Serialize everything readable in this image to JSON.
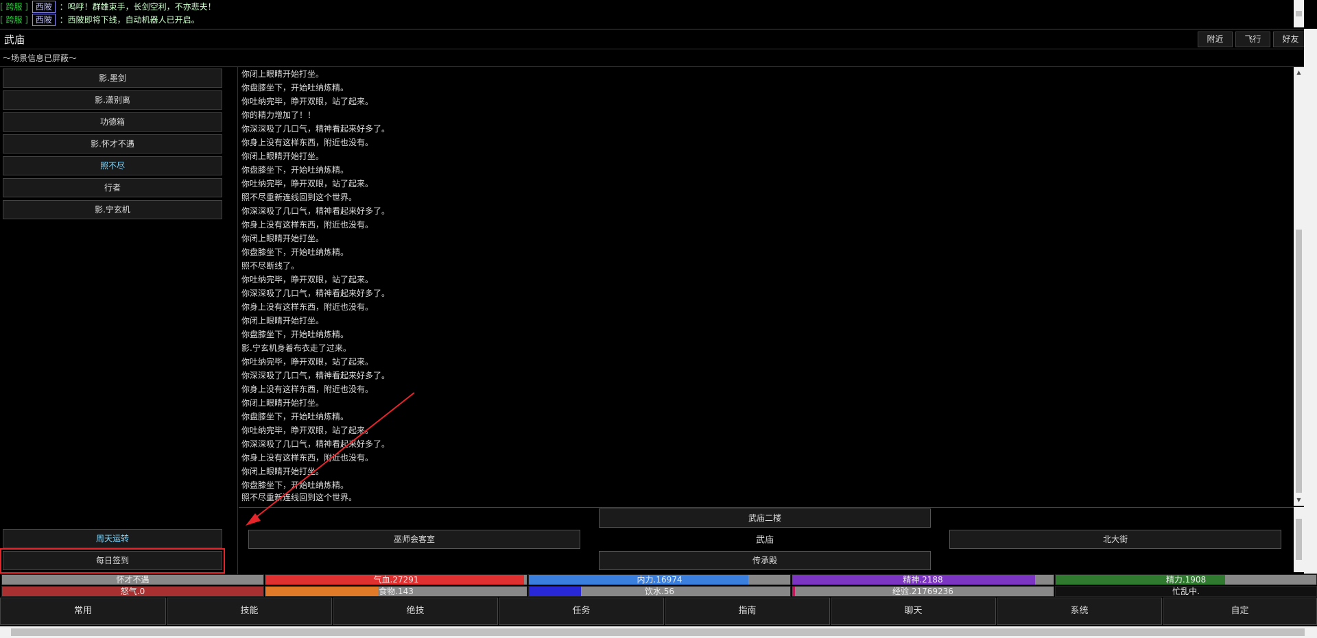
{
  "chat": [
    {
      "channel": "[ 跨服 ]",
      "name": "西陂",
      "message": "：呜呼！群雄束手，长剑空利，不亦悲夫！"
    },
    {
      "channel": "[ 跨服 ]",
      "name": "西陂",
      "message": "：西陂即将下线，自动机器人已开启。"
    }
  ],
  "room": {
    "title": "武庙",
    "scene_notice": "～场景信息已屏蔽～"
  },
  "top_buttons": {
    "nearby": "附近",
    "fly": "飞行",
    "friends": "好友"
  },
  "npcs": [
    "影.墨剑",
    "影.潇别离",
    "功德箱",
    "影.怀才不遇",
    "照不尽",
    "行者",
    "影.宁玄机"
  ],
  "left_actions": {
    "cycle": "周天运转",
    "daily_signin": "每日签到"
  },
  "log": [
    "你闭上眼睛开始打坐。",
    "你盘膝坐下，开始吐纳炼精。",
    "你吐纳完毕，睁开双眼，站了起来。",
    "你的精力增加了！！",
    "你深深吸了几口气，精神看起来好多了。",
    "你身上没有这样东西，附近也没有。",
    "你闭上眼睛开始打坐。",
    "你盘膝坐下，开始吐纳炼精。",
    "你吐纳完毕，睁开双眼，站了起来。",
    "照不尽重新连线回到这个世界。",
    "你深深吸了几口气，精神看起来好多了。",
    "你身上没有这样东西，附近也没有。",
    "你闭上眼睛开始打坐。",
    "你盘膝坐下，开始吐纳炼精。",
    "照不尽断线了。",
    "你吐纳完毕，睁开双眼，站了起来。",
    "你深深吸了几口气，精神看起来好多了。",
    "你身上没有这样东西，附近也没有。",
    "你闭上眼睛开始打坐。",
    "你盘膝坐下，开始吐纳炼精。",
    "影.宁玄机身着布衣走了过来。",
    "你吐纳完毕，睁开双眼，站了起来。",
    "你深深吸了几口气，精神看起来好多了。",
    "你身上没有这样东西，附近也没有。",
    "你闭上眼睛开始打坐。",
    "你盘膝坐下，开始吐纳炼精。",
    "你吐纳完毕，睁开双眼，站了起来。",
    "你深深吸了几口气，精神看起来好多了。",
    "你身上没有这样东西，附近也没有。",
    "你闭上眼睛开始打坐。",
    "你盘膝坐下，开始吐纳炼精。",
    "照不尽重新连线回到这个世界。"
  ],
  "exits": {
    "north": "武庙二楼",
    "west": "巫师会客室",
    "center": "武庙",
    "east": "北大街",
    "south": "传承殿"
  },
  "stats_row1": [
    {
      "label": "怀才不遇",
      "fill": 0.0,
      "color": "#333333"
    },
    {
      "label": "气血.27291",
      "fill": 0.99,
      "color": "#e03030"
    },
    {
      "label": "内力.16974",
      "fill": 0.84,
      "color": "#3a7fdd"
    },
    {
      "label": "精神.2188",
      "fill": 0.93,
      "color": "#7b35c2"
    },
    {
      "label": "精力.1908",
      "fill": 0.65,
      "color": "#2f7a2f"
    }
  ],
  "stats_row2": [
    {
      "label": "怒气.0",
      "fill": 1.0,
      "color": "#a83030"
    },
    {
      "label": "食物.143",
      "fill": 0.43,
      "color": "#e07a28"
    },
    {
      "label": "饮水.56",
      "fill": 0.2,
      "color": "#2828d8"
    },
    {
      "label": "经验.21769236",
      "fill": 0.01,
      "color": "#c2185b"
    },
    {
      "label": "忙乱中.",
      "fill": 0.0,
      "color": "#111111"
    }
  ],
  "menu": [
    "常用",
    "技能",
    "绝技",
    "任务",
    "指南",
    "聊天",
    "系统",
    "自定"
  ],
  "colors": {
    "annotation": "#e5252a",
    "highlight_npc": "#7fd8ff",
    "channel": "#2ecc40"
  }
}
